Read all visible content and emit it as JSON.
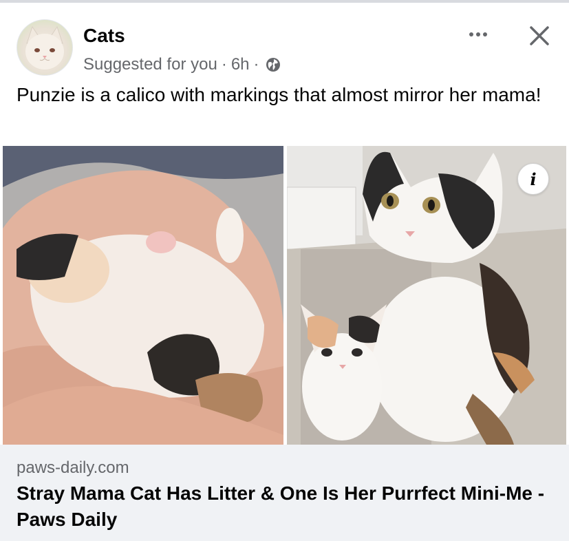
{
  "post": {
    "author": "Cats",
    "suggested": "Suggested for you",
    "time": "6h",
    "separator": "·",
    "audience_icon": "globe-icon",
    "caption": "Punzie is a calico with markings that almost mirror her mama!"
  },
  "actions": {
    "more_icon": "more-options-icon",
    "close_icon": "close-icon"
  },
  "media": {
    "info_label": "i"
  },
  "link": {
    "domain": "paws-daily.com",
    "title": "Stray Mama Cat Has Litter & One Is Her Purrfect Mini-Me - Paws Daily"
  },
  "colors": {
    "text_primary": "#050505",
    "text_secondary": "#65676b",
    "card_bg": "#f0f2f5"
  }
}
